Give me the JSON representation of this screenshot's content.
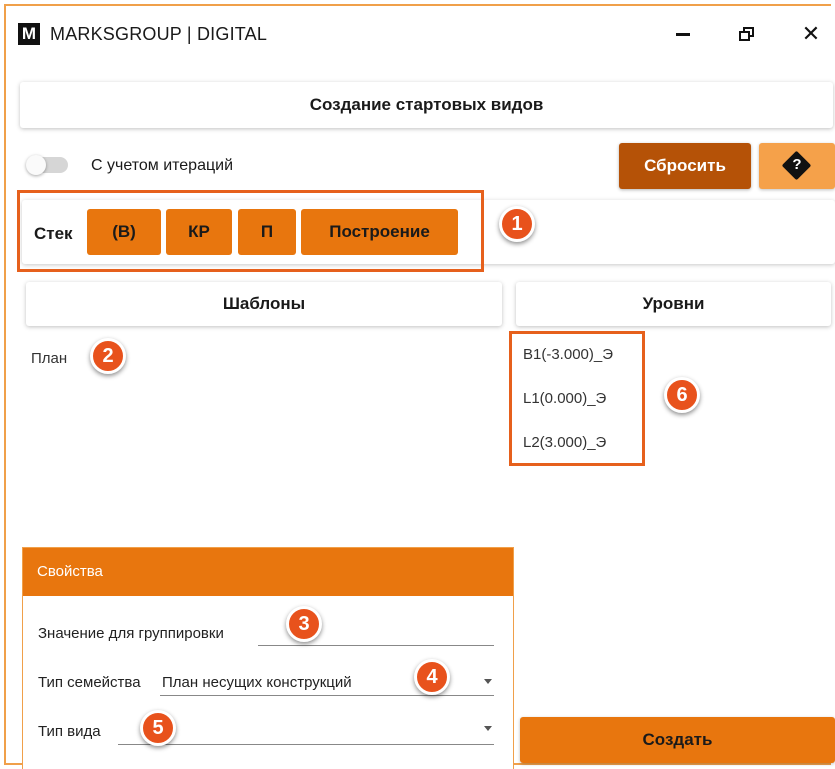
{
  "window": {
    "logo_letter": "M",
    "title": "MARKSGROUP | DIGITAL",
    "minimize_icon": "minimize-icon",
    "restore_icon": "restore-icon",
    "close_glyph": "✕"
  },
  "header": {
    "title": "Создание стартовых видов"
  },
  "toolbar": {
    "iteration_toggle": {
      "label": "С учетом итераций",
      "on": false
    },
    "reset_label": "Сбросить",
    "help_glyph": "?"
  },
  "stack": {
    "label": "Стек",
    "buttons": [
      "(В)",
      "КР",
      "П",
      "Построение"
    ]
  },
  "templates": {
    "header": "Шаблоны",
    "items": [
      "План"
    ]
  },
  "levels": {
    "header": "Уровни",
    "items": [
      "B1(-3.000)_Э",
      "L1(0.000)_Э",
      "L2(3.000)_Э"
    ]
  },
  "properties": {
    "header": "Свойства",
    "grouping_label": "Значение для группировки",
    "grouping_value": "",
    "family_type_label": "Тип семейства",
    "family_type_value": "План несущих конструкций",
    "view_type_label": "Тип вида",
    "view_type_value": ""
  },
  "create_label": "Создать",
  "markers": [
    "1",
    "2",
    "3",
    "4",
    "5",
    "6"
  ],
  "colors": {
    "accent": "#e8760e",
    "reset": "#b55207",
    "help": "#f5a14a",
    "marker": "#e8521c",
    "highlight": "#e6601c"
  }
}
